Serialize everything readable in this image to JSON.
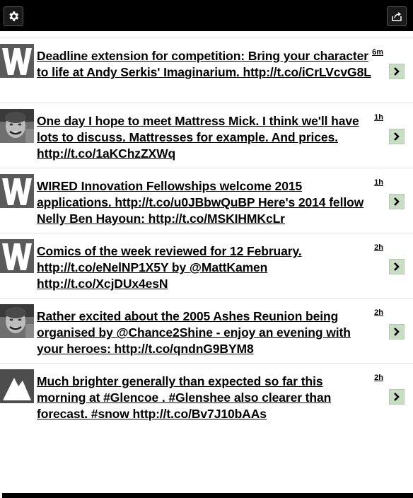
{
  "toolbar": {
    "settings_icon": "gear-icon",
    "share_icon": "share-icon"
  },
  "tweets": [
    {
      "avatar": "wired-w-logo",
      "text": "Deadline extension for competition: Bring your character to life at Andy Serkis' Imaginarium. http://t.co/iCrLVcvG8L",
      "time": "6m"
    },
    {
      "avatar": "person-photo",
      "text": "One day I hope to meet Mattress Mick. I think we'll have lots to discuss. Mattresses for example. And prices. http://t.co/1aKChzZXWq",
      "time": "1h"
    },
    {
      "avatar": "wired-w-logo",
      "text": "WIRED Innovation Fellowships welcome 2015 applications. http://t.co/u0JBbwQuBP Here's 2014 fellow Nelly Ben Hayoun: http://t.co/MSKIHMKcLr",
      "time": "1h"
    },
    {
      "avatar": "wired-w-logo",
      "text": "Comics of the week reviewed for 12 February. http://t.co/eNelNP1X5Y by @MattKamen http://t.co/XcjDUx4esN",
      "time": "2h"
    },
    {
      "avatar": "person-photo",
      "text": "Rather excited about the 2005 Ashes Reunion being organised by @Chance2Shine - enjoy an evening with your heroes: http://t.co/qndnG9BYM8",
      "time": "2h"
    },
    {
      "avatar": "mountain-logo",
      "text": "Much brighter generally than expected so far this morning at #Glencoe . #Glenshee also clearer than forecast. #snow http://t.co/Bv7J10bAAs",
      "time": "2h"
    }
  ]
}
